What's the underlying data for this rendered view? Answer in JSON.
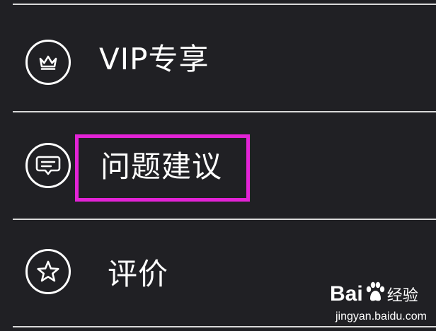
{
  "menu": {
    "items": [
      {
        "label": "VIP专享",
        "icon": "crown-icon"
      },
      {
        "label": "问题建议",
        "icon": "feedback-chat-icon",
        "highlighted": true
      },
      {
        "label": "评价",
        "icon": "star-icon"
      }
    ]
  },
  "annotation": {
    "highlight_color": "#e323d6"
  },
  "watermark": {
    "brand_prefix": "Bai",
    "brand_suffix": "经验",
    "url": "jingyan.baidu.com"
  },
  "colors": {
    "background": "#202024",
    "text": "#ffffff",
    "divider": "#d9d9d9"
  }
}
